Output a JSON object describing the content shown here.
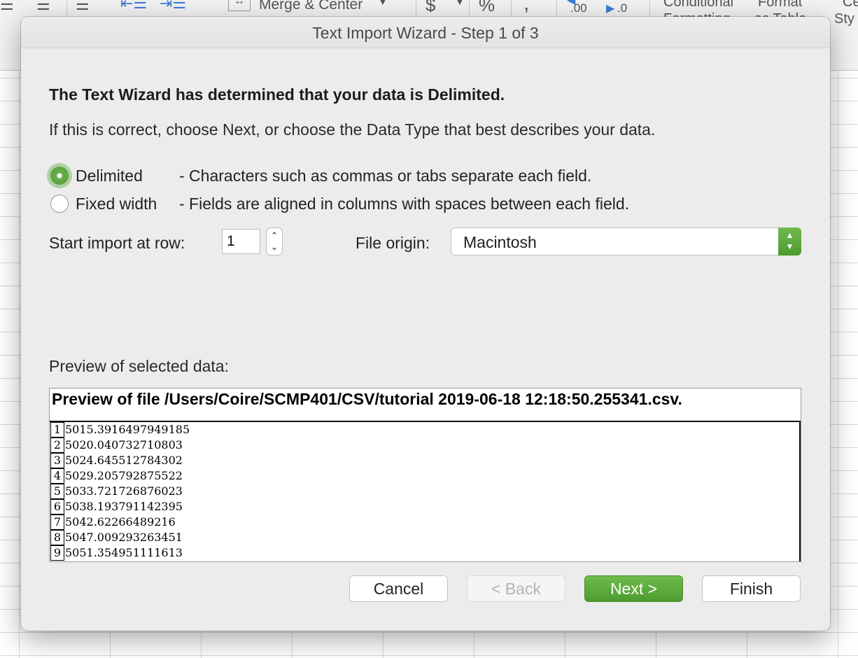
{
  "ribbon": {
    "merge_label": "Merge & Center",
    "currency_symbol": "$",
    "percent_symbol": "%",
    "comma_symbol": ",",
    "increase_decimal_label": ".00",
    "decrease_decimal_label": ".0",
    "conditional_formatting_line1": "Conditional",
    "conditional_formatting_line2": "Formatting",
    "format_as_table_line1": "Format",
    "format_as_table_line2": "as Table",
    "cell_styles_line1": "Ce",
    "cell_styles_line2": "Sty"
  },
  "dialog": {
    "title": "Text Import Wizard - Step 1 of 3",
    "heading": "The Text Wizard has determined that your data is Delimited.",
    "subtext": "If this is correct, choose Next, or choose the Data Type that best describes your data.",
    "options": [
      {
        "label": "Delimited",
        "description": "- Characters such as commas or tabs separate each field.",
        "selected": true
      },
      {
        "label": "Fixed width",
        "description": "- Fields are aligned in columns with spaces between each field.",
        "selected": false
      }
    ],
    "start_row_label": "Start import at row:",
    "start_row_value": "1",
    "file_origin_label": "File origin:",
    "file_origin_value": "Macintosh",
    "preview_label": "Preview of selected data:",
    "preview_file": "Preview of file /Users/Coire/SCMP401/CSV/tutorial 2019-06-18 12:18:50.255341.csv.",
    "preview_rows": [
      {
        "num": "1",
        "value": "5015.3916497949185"
      },
      {
        "num": "2",
        "value": "5020.040732710803"
      },
      {
        "num": "3",
        "value": "5024.645512784302"
      },
      {
        "num": "4",
        "value": "5029.205792875522"
      },
      {
        "num": "5",
        "value": "5033.721726876023"
      },
      {
        "num": "6",
        "value": "5038.193791142395"
      },
      {
        "num": "7",
        "value": "5042.62266489216"
      },
      {
        "num": "8",
        "value": "5047.009293263451"
      },
      {
        "num": "9",
        "value": "5051.354951111613"
      }
    ],
    "buttons": {
      "cancel": "Cancel",
      "back": "< Back",
      "next": "Next >",
      "finish": "Finish"
    }
  },
  "colors": {
    "accent_green": "#5aa83a",
    "dialog_bg": "#ececec"
  }
}
